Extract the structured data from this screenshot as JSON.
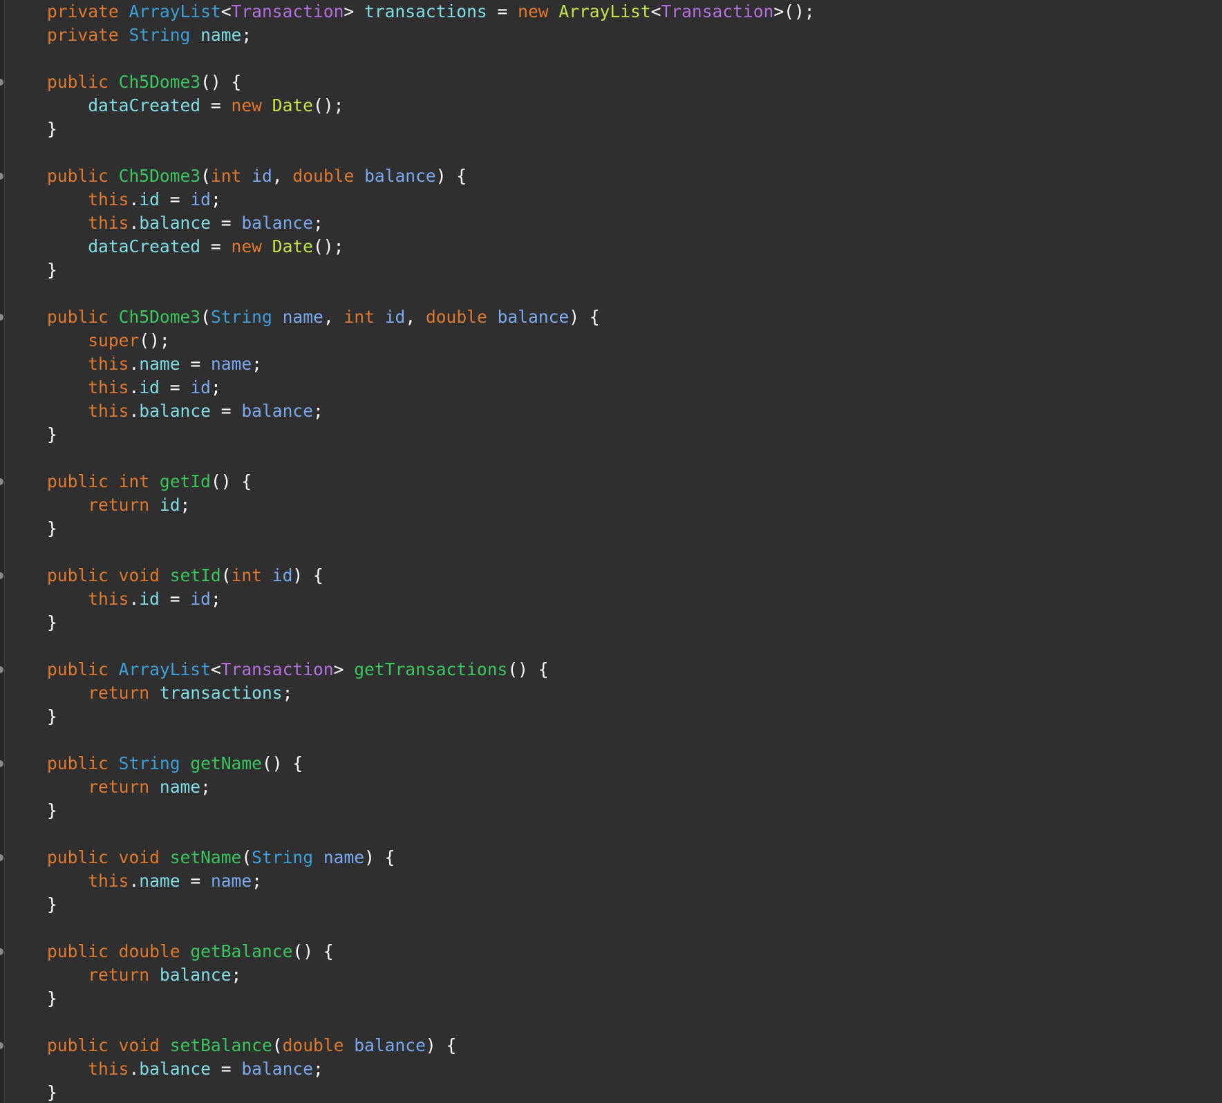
{
  "editor": {
    "lines": [
      {
        "fold": false,
        "tokens": [
          [
            "kw",
            "private "
          ],
          [
            "ty",
            "ArrayList"
          ],
          [
            "pun",
            "<"
          ],
          [
            "gen",
            "Transaction"
          ],
          [
            "pun",
            "> "
          ],
          [
            "fld",
            "transactions"
          ],
          [
            "pun",
            " = "
          ],
          [
            "kw",
            "new "
          ],
          [
            "cls",
            "ArrayList"
          ],
          [
            "pun",
            "<"
          ],
          [
            "gen",
            "Transaction"
          ],
          [
            "pun",
            ">();"
          ]
        ]
      },
      {
        "fold": false,
        "tokens": [
          [
            "kw",
            "private "
          ],
          [
            "ty",
            "String "
          ],
          [
            "fld",
            "name"
          ],
          [
            "pun",
            ";"
          ]
        ]
      },
      {
        "fold": false,
        "tokens": []
      },
      {
        "fold": true,
        "tokens": [
          [
            "kw",
            "public "
          ],
          [
            "ctor",
            "Ch5Dome3"
          ],
          [
            "pun",
            "() {"
          ]
        ]
      },
      {
        "fold": false,
        "tokens": [
          [
            "pun",
            "    "
          ],
          [
            "fld",
            "dataCreated"
          ],
          [
            "pun",
            " = "
          ],
          [
            "kw",
            "new "
          ],
          [
            "cls",
            "Date"
          ],
          [
            "pun",
            "();"
          ]
        ]
      },
      {
        "fold": false,
        "tokens": [
          [
            "pun",
            "}"
          ]
        ]
      },
      {
        "fold": false,
        "tokens": []
      },
      {
        "fold": true,
        "tokens": [
          [
            "kw",
            "public "
          ],
          [
            "ctor",
            "Ch5Dome3"
          ],
          [
            "pun",
            "("
          ],
          [
            "kw",
            "int "
          ],
          [
            "prm",
            "id"
          ],
          [
            "pun",
            ", "
          ],
          [
            "kw",
            "double "
          ],
          [
            "prm",
            "balance"
          ],
          [
            "pun",
            ") {"
          ]
        ]
      },
      {
        "fold": false,
        "tokens": [
          [
            "pun",
            "    "
          ],
          [
            "kw",
            "this"
          ],
          [
            "pun",
            "."
          ],
          [
            "fld",
            "id"
          ],
          [
            "pun",
            " = "
          ],
          [
            "prm",
            "id"
          ],
          [
            "pun",
            ";"
          ]
        ]
      },
      {
        "fold": false,
        "tokens": [
          [
            "pun",
            "    "
          ],
          [
            "kw",
            "this"
          ],
          [
            "pun",
            "."
          ],
          [
            "fld",
            "balance"
          ],
          [
            "pun",
            " = "
          ],
          [
            "prm",
            "balance"
          ],
          [
            "pun",
            ";"
          ]
        ]
      },
      {
        "fold": false,
        "tokens": [
          [
            "pun",
            "    "
          ],
          [
            "fld",
            "dataCreated"
          ],
          [
            "pun",
            " = "
          ],
          [
            "kw",
            "new "
          ],
          [
            "cls",
            "Date"
          ],
          [
            "pun",
            "();"
          ]
        ]
      },
      {
        "fold": false,
        "tokens": [
          [
            "pun",
            "}"
          ]
        ]
      },
      {
        "fold": false,
        "tokens": []
      },
      {
        "fold": true,
        "tokens": [
          [
            "kw",
            "public "
          ],
          [
            "ctor",
            "Ch5Dome3"
          ],
          [
            "pun",
            "("
          ],
          [
            "ty",
            "String "
          ],
          [
            "prm",
            "name"
          ],
          [
            "pun",
            ", "
          ],
          [
            "kw",
            "int "
          ],
          [
            "prm",
            "id"
          ],
          [
            "pun",
            ", "
          ],
          [
            "kw",
            "double "
          ],
          [
            "prm",
            "balance"
          ],
          [
            "pun",
            ") {"
          ]
        ]
      },
      {
        "fold": false,
        "tokens": [
          [
            "pun",
            "    "
          ],
          [
            "kw",
            "super"
          ],
          [
            "pun",
            "();"
          ]
        ]
      },
      {
        "fold": false,
        "tokens": [
          [
            "pun",
            "    "
          ],
          [
            "kw",
            "this"
          ],
          [
            "pun",
            "."
          ],
          [
            "fld",
            "name"
          ],
          [
            "pun",
            " = "
          ],
          [
            "prm",
            "name"
          ],
          [
            "pun",
            ";"
          ]
        ]
      },
      {
        "fold": false,
        "tokens": [
          [
            "pun",
            "    "
          ],
          [
            "kw",
            "this"
          ],
          [
            "pun",
            "."
          ],
          [
            "fld",
            "id"
          ],
          [
            "pun",
            " = "
          ],
          [
            "prm",
            "id"
          ],
          [
            "pun",
            ";"
          ]
        ]
      },
      {
        "fold": false,
        "tokens": [
          [
            "pun",
            "    "
          ],
          [
            "kw",
            "this"
          ],
          [
            "pun",
            "."
          ],
          [
            "fld",
            "balance"
          ],
          [
            "pun",
            " = "
          ],
          [
            "prm",
            "balance"
          ],
          [
            "pun",
            ";"
          ]
        ]
      },
      {
        "fold": false,
        "tokens": [
          [
            "pun",
            "}"
          ]
        ]
      },
      {
        "fold": false,
        "tokens": []
      },
      {
        "fold": true,
        "tokens": [
          [
            "kw",
            "public "
          ],
          [
            "kw",
            "int "
          ],
          [
            "mth",
            "getId"
          ],
          [
            "pun",
            "() {"
          ]
        ]
      },
      {
        "fold": false,
        "tokens": [
          [
            "pun",
            "    "
          ],
          [
            "kw",
            "return "
          ],
          [
            "fld",
            "id"
          ],
          [
            "pun",
            ";"
          ]
        ]
      },
      {
        "fold": false,
        "tokens": [
          [
            "pun",
            "}"
          ]
        ]
      },
      {
        "fold": false,
        "tokens": []
      },
      {
        "fold": true,
        "tokens": [
          [
            "kw",
            "public "
          ],
          [
            "kw",
            "void "
          ],
          [
            "mth",
            "setId"
          ],
          [
            "pun",
            "("
          ],
          [
            "kw",
            "int "
          ],
          [
            "prm",
            "id"
          ],
          [
            "pun",
            ") {"
          ]
        ]
      },
      {
        "fold": false,
        "tokens": [
          [
            "pun",
            "    "
          ],
          [
            "kw",
            "this"
          ],
          [
            "pun",
            "."
          ],
          [
            "fld",
            "id"
          ],
          [
            "pun",
            " = "
          ],
          [
            "prm",
            "id"
          ],
          [
            "pun",
            ";"
          ]
        ]
      },
      {
        "fold": false,
        "tokens": [
          [
            "pun",
            "}"
          ]
        ]
      },
      {
        "fold": false,
        "tokens": []
      },
      {
        "fold": true,
        "tokens": [
          [
            "kw",
            "public "
          ],
          [
            "ty",
            "ArrayList"
          ],
          [
            "pun",
            "<"
          ],
          [
            "gen",
            "Transaction"
          ],
          [
            "pun",
            "> "
          ],
          [
            "mth",
            "getTransactions"
          ],
          [
            "pun",
            "() {"
          ]
        ]
      },
      {
        "fold": false,
        "tokens": [
          [
            "pun",
            "    "
          ],
          [
            "kw",
            "return "
          ],
          [
            "fld",
            "transactions"
          ],
          [
            "pun",
            ";"
          ]
        ]
      },
      {
        "fold": false,
        "tokens": [
          [
            "pun",
            "}"
          ]
        ]
      },
      {
        "fold": false,
        "tokens": []
      },
      {
        "fold": true,
        "tokens": [
          [
            "kw",
            "public "
          ],
          [
            "ty",
            "String "
          ],
          [
            "mth",
            "getName"
          ],
          [
            "pun",
            "() {"
          ]
        ]
      },
      {
        "fold": false,
        "tokens": [
          [
            "pun",
            "    "
          ],
          [
            "kw",
            "return "
          ],
          [
            "fld",
            "name"
          ],
          [
            "pun",
            ";"
          ]
        ]
      },
      {
        "fold": false,
        "tokens": [
          [
            "pun",
            "}"
          ]
        ]
      },
      {
        "fold": false,
        "tokens": []
      },
      {
        "fold": true,
        "tokens": [
          [
            "kw",
            "public "
          ],
          [
            "kw",
            "void "
          ],
          [
            "mth",
            "setName"
          ],
          [
            "pun",
            "("
          ],
          [
            "ty",
            "String "
          ],
          [
            "prm",
            "name"
          ],
          [
            "pun",
            ") {"
          ]
        ]
      },
      {
        "fold": false,
        "tokens": [
          [
            "pun",
            "    "
          ],
          [
            "kw",
            "this"
          ],
          [
            "pun",
            "."
          ],
          [
            "fld",
            "name"
          ],
          [
            "pun",
            " = "
          ],
          [
            "prm",
            "name"
          ],
          [
            "pun",
            ";"
          ]
        ]
      },
      {
        "fold": false,
        "tokens": [
          [
            "pun",
            "}"
          ]
        ]
      },
      {
        "fold": false,
        "tokens": []
      },
      {
        "fold": true,
        "tokens": [
          [
            "kw",
            "public "
          ],
          [
            "kw",
            "double "
          ],
          [
            "mth",
            "getBalance"
          ],
          [
            "pun",
            "() {"
          ]
        ]
      },
      {
        "fold": false,
        "tokens": [
          [
            "pun",
            "    "
          ],
          [
            "kw",
            "return "
          ],
          [
            "fld",
            "balance"
          ],
          [
            "pun",
            ";"
          ]
        ]
      },
      {
        "fold": false,
        "tokens": [
          [
            "pun",
            "}"
          ]
        ]
      },
      {
        "fold": false,
        "tokens": []
      },
      {
        "fold": true,
        "tokens": [
          [
            "kw",
            "public "
          ],
          [
            "kw",
            "void "
          ],
          [
            "mth",
            "setBalance"
          ],
          [
            "pun",
            "("
          ],
          [
            "kw",
            "double "
          ],
          [
            "prm",
            "balance"
          ],
          [
            "pun",
            ") {"
          ]
        ]
      },
      {
        "fold": false,
        "tokens": [
          [
            "pun",
            "    "
          ],
          [
            "kw",
            "this"
          ],
          [
            "pun",
            "."
          ],
          [
            "fld",
            "balance"
          ],
          [
            "pun",
            " = "
          ],
          [
            "prm",
            "balance"
          ],
          [
            "pun",
            ";"
          ]
        ]
      },
      {
        "fold": false,
        "tokens": [
          [
            "pun",
            "}"
          ]
        ]
      }
    ]
  },
  "colors": {
    "background": "#2f2f2f",
    "keyword": "#e0782d",
    "type": "#3d9fd9",
    "generic": "#b26fdd",
    "field": "#7fdde4",
    "parameter": "#7aa9ef",
    "method": "#3bc55d",
    "class_ref": "#c3e54a",
    "punctuation": "#ffffff"
  }
}
